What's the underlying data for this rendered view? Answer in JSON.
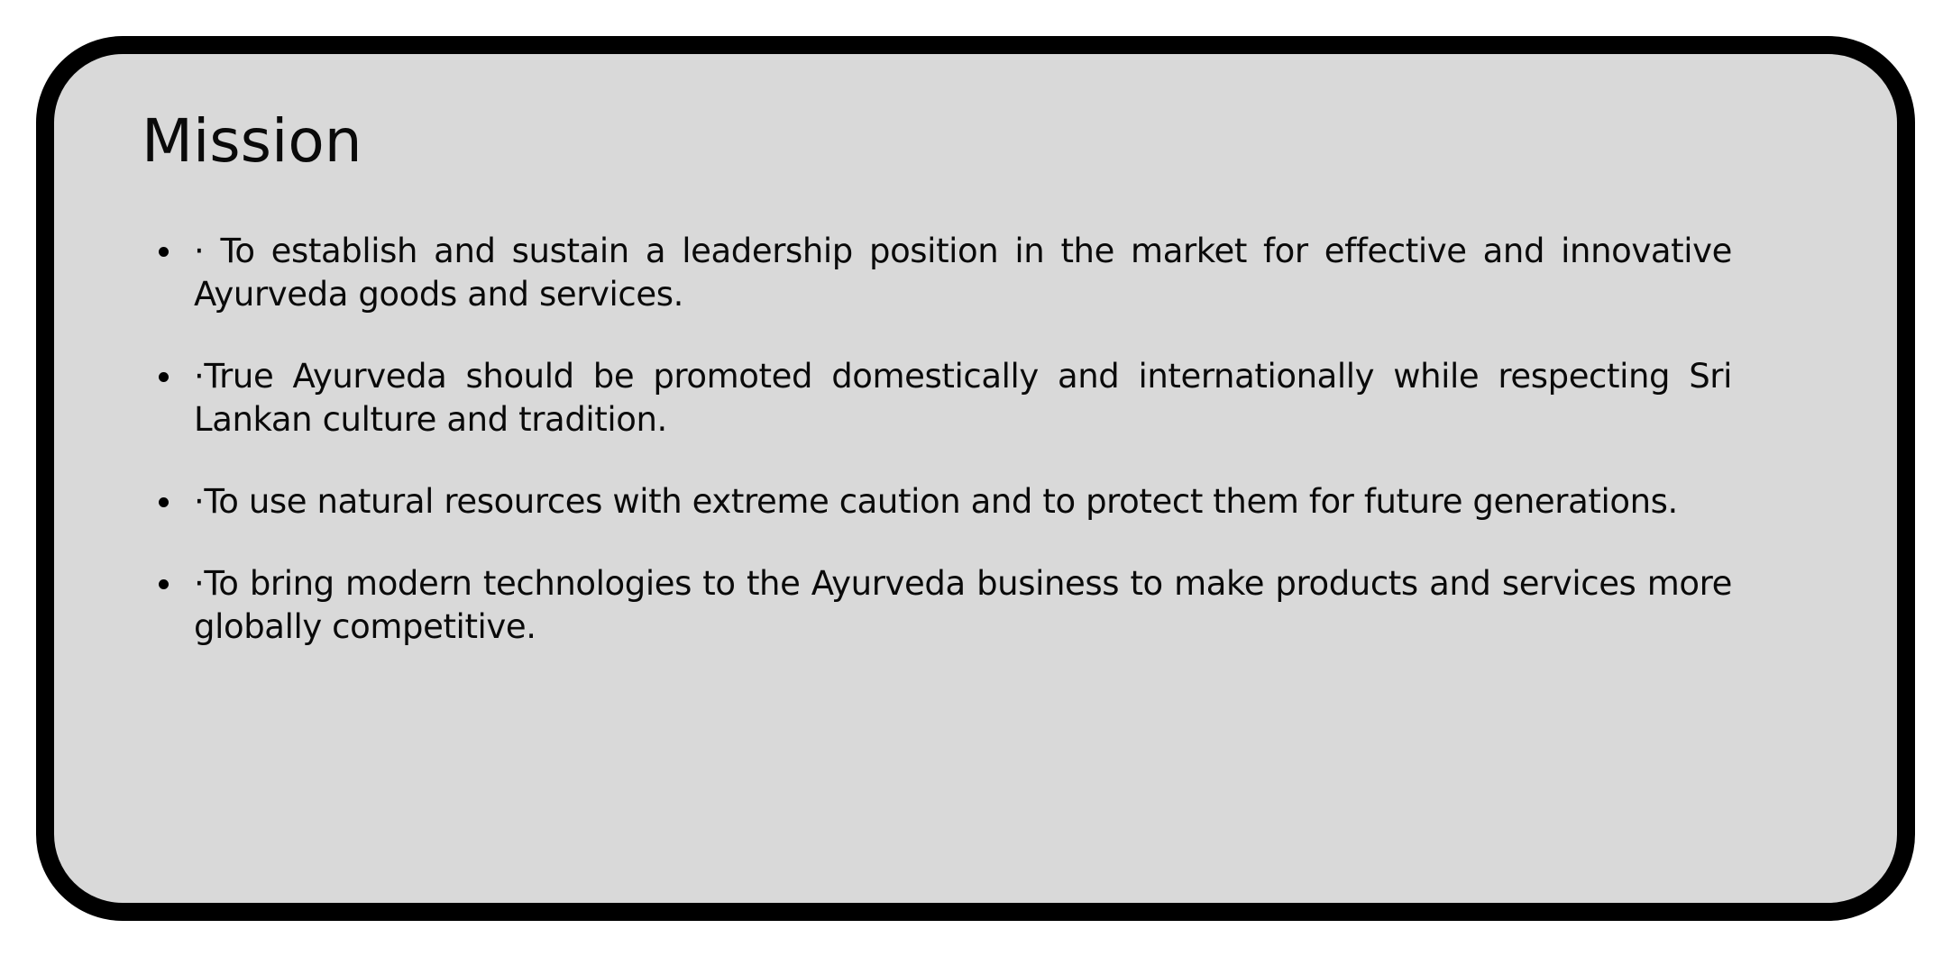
{
  "colors": {
    "page_background": "#ffffff",
    "card_background": "#d9d9d9",
    "card_border": "#000000",
    "text": "#0a0a0a"
  },
  "mission": {
    "title": "Mission",
    "items": [
      {
        "text": "· To establish and sustain a leadership position in the market for effective and innovative Ayurveda goods and services."
      },
      {
        "text": "·True Ayurveda should be promoted domestically and internationally while respecting Sri Lankan culture and tradition."
      },
      {
        "text": "·To use natural resources with extreme caution and to protect them for future generations."
      },
      {
        "text": "·To bring modern technologies to the Ayurveda business to make products and services more globally competitive."
      }
    ]
  }
}
